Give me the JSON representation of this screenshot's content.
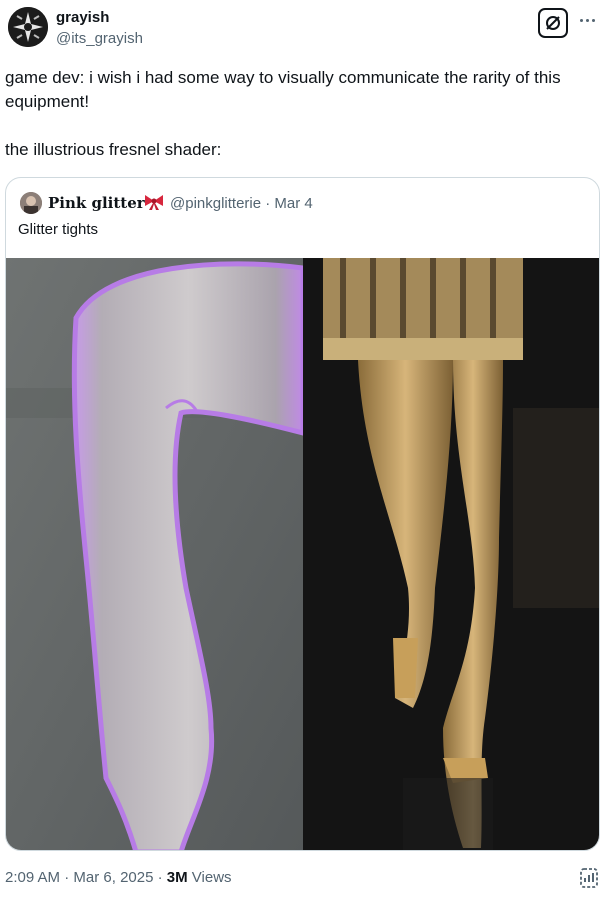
{
  "author": {
    "display_name": "grayish",
    "handle": "@its_grayish",
    "avatar_icon": "star-logo-avatar"
  },
  "header": {
    "grok_icon": "slashed-circle-icon",
    "more_icon": "ellipsis-icon"
  },
  "tweet": {
    "text": "game dev: i wish i had some way to visually communicate the rarity of this equipment!\n\nthe illustrious fresnel shader:"
  },
  "quote": {
    "display_name": "Pink glitter",
    "emoji": "red-bow-emoji",
    "meta": "@pinkglitterie · Mar 4",
    "text": "Glitter tights",
    "media": [
      {
        "description_icon": "purple-glitter-tights-photo"
      },
      {
        "description_icon": "gold-glitter-tights-runway-photo"
      }
    ]
  },
  "footer": {
    "time": "2:09 AM",
    "separator1": "·",
    "date": "Mar 6, 2025",
    "separator2": "·",
    "views_count": "3M",
    "views_label": "Views",
    "analytics_icon": "analytics-icon"
  },
  "colors": {
    "text_primary": "#0f1419",
    "text_secondary": "#536471",
    "border": "#cfd9de",
    "glitter_purple": "#b07be0",
    "glitter_gold": "#c8a45a"
  }
}
